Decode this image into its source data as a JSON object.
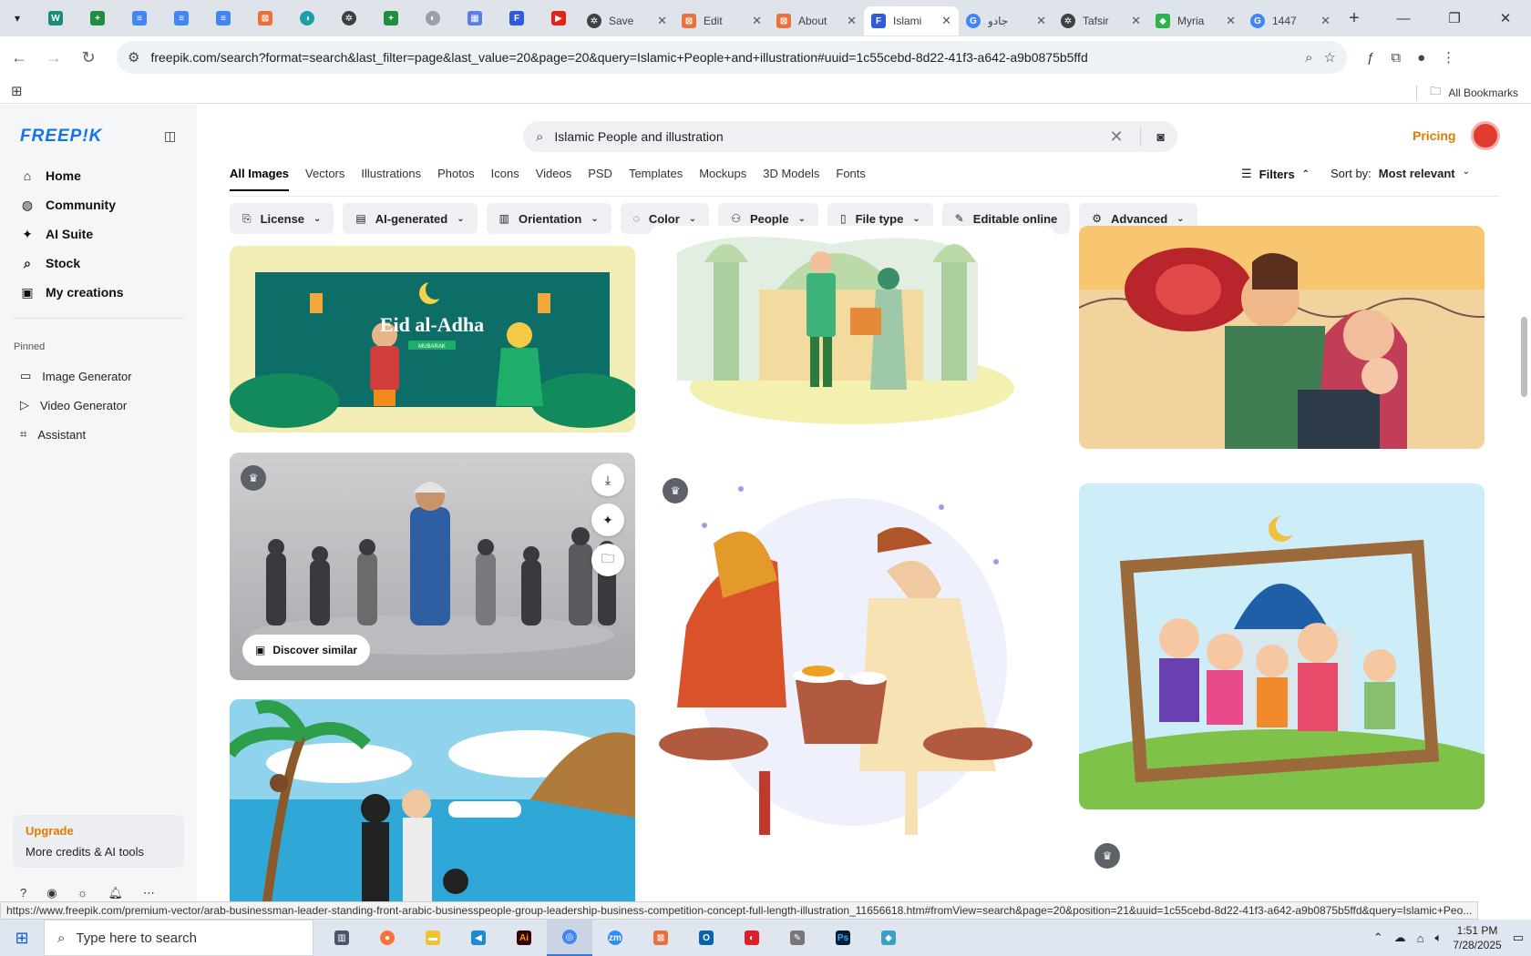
{
  "browser": {
    "tabs": [
      {
        "title": "Save",
        "icon_color": "#3c4043"
      },
      {
        "title": "Edit",
        "icon_color": "#e8713c"
      },
      {
        "title": "About",
        "icon_color": "#e8713c"
      },
      {
        "title": "Islami",
        "icon_color": "#2f5bd9",
        "active": true
      },
      {
        "title": "جادو",
        "icon_color": "#4285f4"
      },
      {
        "title": "Tafsir",
        "icon_color": "#3c4043"
      },
      {
        "title": "Myria",
        "icon_color": "#2db34a"
      },
      {
        "title": "1447",
        "icon_color": "#4285f4"
      }
    ],
    "url": "freepik.com/search?format=search&last_filter=page&last_value=20&page=20&query=Islamic+People+and+illustration#uuid=1c55cebd-8d22-41f3-a642-a9b0875b5ffd",
    "bookmarks_label": "All Bookmarks",
    "status_url": "https://www.freepik.com/premium-vector/arab-businessman-leader-standing-front-arabic-businesspeople-group-leadership-business-competition-concept-full-length-illustration_11656618.htm#fromView=search&page=20&position=21&uuid=1c55cebd-8d22-41f3-a642-a9b0875b5ffd&query=Islamic+Peo..."
  },
  "sidebar": {
    "logo": "FREEP!K",
    "nav": [
      {
        "label": "Home",
        "icon": "home-icon"
      },
      {
        "label": "Community",
        "icon": "globe-icon"
      },
      {
        "label": "AI Suite",
        "icon": "sparkle-icon"
      },
      {
        "label": "Stock",
        "icon": "search-icon"
      },
      {
        "label": "My creations",
        "icon": "folder-icon"
      }
    ],
    "pinned_title": "Pinned",
    "pinned": [
      {
        "label": "Image Generator",
        "icon": "image-icon"
      },
      {
        "label": "Video Generator",
        "icon": "video-icon"
      },
      {
        "label": "Assistant",
        "icon": "chat-icon"
      }
    ],
    "upgrade": {
      "title": "Upgrade",
      "subtitle": "More credits & AI tools"
    }
  },
  "search": {
    "value": "Islamic People and illustration"
  },
  "header": {
    "pricing": "Pricing"
  },
  "type_tabs": [
    "All Images",
    "Vectors",
    "Illustrations",
    "Photos",
    "Icons",
    "Videos",
    "PSD",
    "Templates",
    "Mockups",
    "3D Models",
    "Fonts"
  ],
  "filters": {
    "label": "Filters",
    "sort_label": "Sort by:",
    "sort_value": "Most relevant"
  },
  "chips": [
    {
      "label": "License",
      "icon": "license-icon"
    },
    {
      "label": "AI-generated",
      "icon": "ai-icon"
    },
    {
      "label": "Orientation",
      "icon": "orientation-icon"
    },
    {
      "label": "Color",
      "icon": "palette-icon"
    },
    {
      "label": "People",
      "icon": "people-icon"
    },
    {
      "label": "File type",
      "icon": "file-icon"
    },
    {
      "label": "Editable online",
      "icon": "pencil-icon"
    },
    {
      "label": "Advanced",
      "icon": "gear-icon"
    }
  ],
  "cards": {
    "eid_text": "Eid al-Adha",
    "eid_sub": "MUBARAK",
    "discover": "Discover similar"
  },
  "taskbar": {
    "search_placeholder": "Type here to search",
    "time": "1:51 PM",
    "date": "7/28/2025"
  }
}
